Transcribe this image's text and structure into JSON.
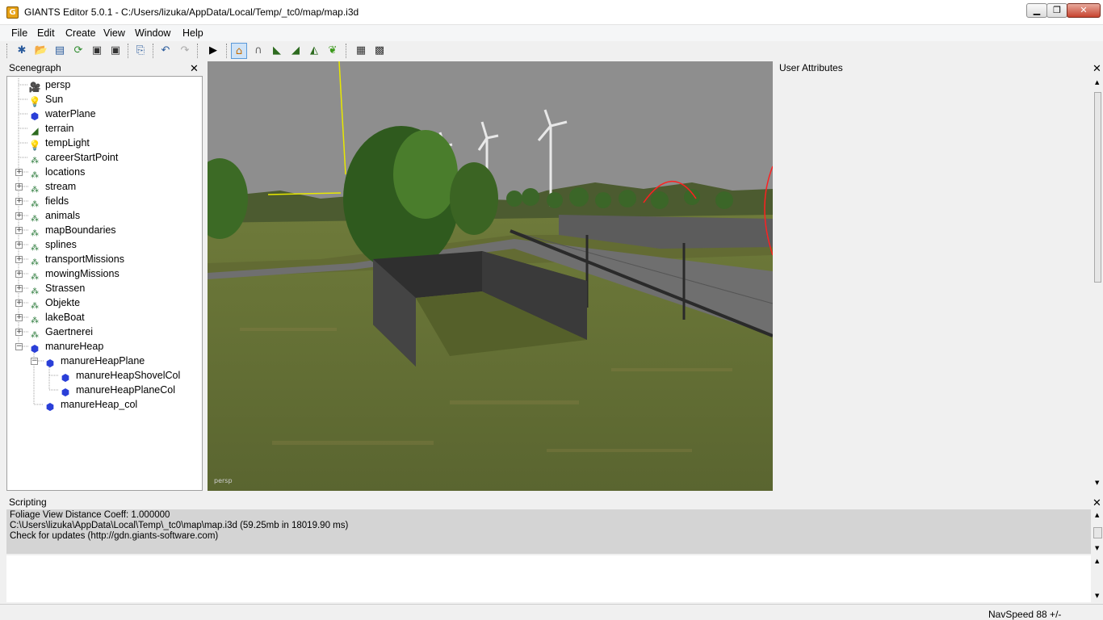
{
  "window": {
    "app_icon_letter": "G",
    "title": "GIANTS Editor 5.0.1 - C:/Users/lizuka/AppData/Local/Temp/_tc0/map/map.i3d"
  },
  "menu": [
    {
      "id": "file",
      "label": "File"
    },
    {
      "id": "edit",
      "label": "Edit"
    },
    {
      "id": "create",
      "label": "Create"
    },
    {
      "id": "view",
      "label": "View"
    },
    {
      "id": "window",
      "label": "Window"
    },
    {
      "id": "help",
      "label": "Help"
    }
  ],
  "scenegraph": {
    "title": "Scenegraph",
    "items": [
      {
        "label": "persp",
        "icon": "camera-icon"
      },
      {
        "label": "Sun",
        "icon": "light-bulb-icon"
      },
      {
        "label": "waterPlane",
        "icon": "cube-icon"
      },
      {
        "label": "terrain",
        "icon": "terrain-icon"
      },
      {
        "label": "tempLight",
        "icon": "light-bulb-icon"
      },
      {
        "label": "careerStartPoint",
        "icon": "transform-group-icon"
      },
      {
        "label": "locations",
        "icon": "transform-group-icon"
      },
      {
        "label": "stream",
        "icon": "transform-group-icon"
      },
      {
        "label": "fields",
        "icon": "transform-group-icon"
      },
      {
        "label": "animals",
        "icon": "transform-group-icon"
      },
      {
        "label": "mapBoundaries",
        "icon": "transform-group-icon"
      },
      {
        "label": "splines",
        "icon": "transform-group-icon"
      },
      {
        "label": "transportMissions",
        "icon": "transform-group-icon"
      },
      {
        "label": "mowingMissions",
        "icon": "transform-group-icon"
      },
      {
        "label": "Strassen",
        "icon": "transform-group-icon"
      },
      {
        "label": "Objekte",
        "icon": "transform-group-icon"
      },
      {
        "label": "lakeBoat",
        "icon": "transform-group-icon"
      },
      {
        "label": "Gaertnerei",
        "icon": "transform-group-icon"
      },
      {
        "label": "manureHeap",
        "icon": "cube-icon"
      },
      {
        "label": "manureHeapPlane",
        "icon": "cube-icon"
      },
      {
        "label": "manureHeapShovelCol",
        "icon": "cube-icon"
      },
      {
        "label": "manureHeapPlaneCol",
        "icon": "cube-icon"
      },
      {
        "label": "manureHeap_col",
        "icon": "cube-icon"
      }
    ]
  },
  "viewport": {
    "camera_label": "persp"
  },
  "user_attributes": {
    "title": "User Attributes"
  },
  "scripting": {
    "title": "Scripting",
    "log": [
      "  Foliage View Distance Coeff: 1.000000",
      "C:\\Users\\lizuka\\AppData\\Local\\Temp\\_tc0\\map\\map.i3d (59.25mb in 18019.90 ms)",
      "Check for updates (http://gdn.giants-software.com)"
    ]
  },
  "status": {
    "nav_speed": "NavSpeed 88 +/-"
  },
  "colors": {
    "sky": "#8e8e8e",
    "grass": "#5d6b2d",
    "wall": "#3a3a3a",
    "selection_yellow": "#e8e800",
    "gizmo_red": "#ff2020"
  }
}
